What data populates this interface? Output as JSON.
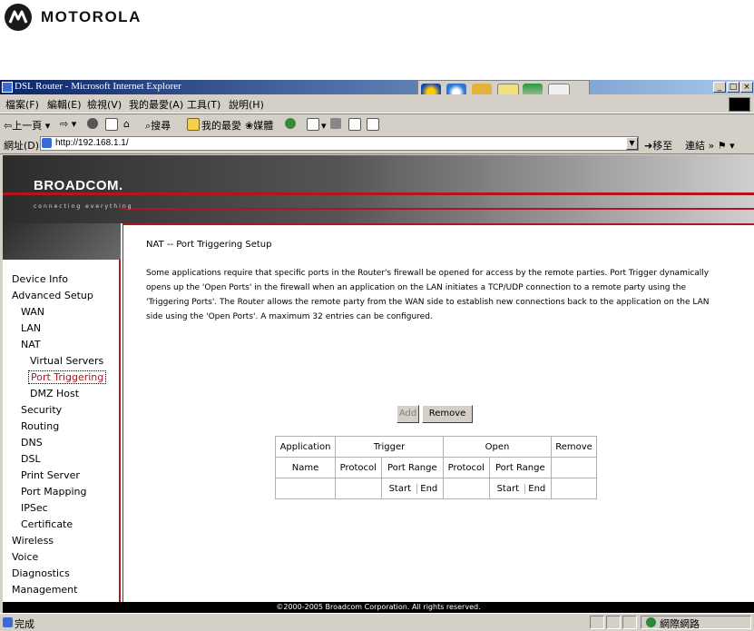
{
  "banner": {
    "brand": "MOTOROLA"
  },
  "window": {
    "title": "DSL Router - Microsoft Internet Explorer",
    "controls": {
      "minimize": "_",
      "maximize": "□",
      "close": "×"
    }
  },
  "menu": [
    "檔案(F)",
    "編輯(E)",
    "檢視(V)",
    "我的最愛(A)",
    "工具(T)",
    "說明(H)"
  ],
  "toolbar": {
    "back": "上一頁",
    "search": "搜尋",
    "favorites": "我的最愛",
    "media": "媒體"
  },
  "address": {
    "label": "網址(D)",
    "url": "http://192.168.1.1/",
    "go": "移至",
    "links": "連結"
  },
  "header": {
    "brand": "BROADCOM.",
    "tagline": "connecting everything"
  },
  "sidebar": {
    "items": [
      "Device Info",
      "Advanced Setup",
      "WAN",
      "LAN",
      "NAT",
      "Virtual Servers",
      "Port Triggering",
      "DMZ Host",
      "Security",
      "Routing",
      "DNS",
      "DSL",
      "Print Server",
      "Port Mapping",
      "IPSec",
      "Certificate",
      "Wireless",
      "Voice",
      "Diagnostics",
      "Management"
    ],
    "active": "Port Triggering"
  },
  "main": {
    "title": "NAT -- Port Triggering Setup",
    "description": "Some applications require that specific ports in the Router's firewall be opened for access by the remote parties. Port Trigger dynamically opens up the 'Open Ports' in the firewall when an application on the LAN initiates a TCP/UDP connection to a remote party using the 'Triggering Ports'. The Router allows the remote party from the WAN side to establish new connections back to the application on the LAN side using the 'Open Ports'. A maximum 32 entries can be configured.",
    "buttons": {
      "add": "Add",
      "remove": "Remove"
    },
    "table": {
      "application": "Application",
      "trigger": "Trigger",
      "open": "Open",
      "remove": "Remove",
      "name": "Name",
      "protocol": "Protocol",
      "port_range": "Port Range",
      "start": "Start",
      "end": "End"
    }
  },
  "footer": "©2000-2005 Broadcom Corporation. All rights reserved.",
  "status": {
    "text": "完成",
    "zone": "網際網路"
  }
}
